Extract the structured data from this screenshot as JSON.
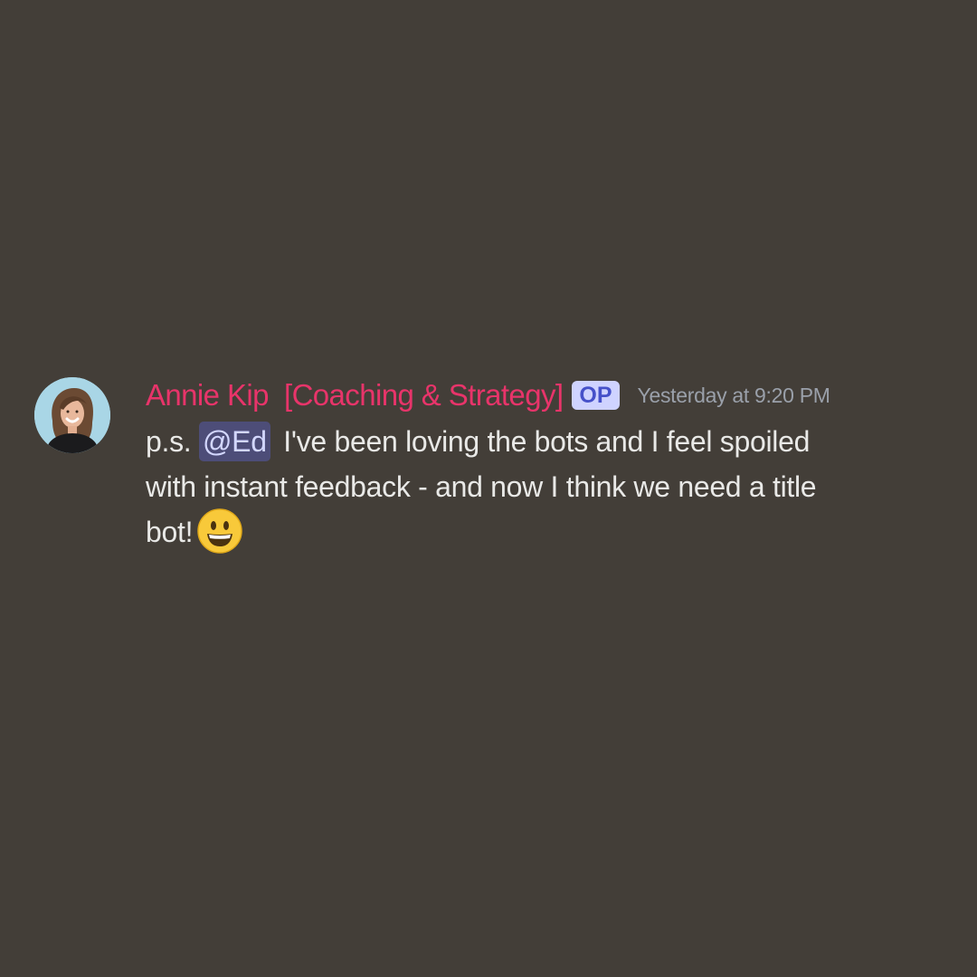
{
  "message": {
    "author": "Annie Kip  [Coaching & Strategy]",
    "badge": "OP",
    "timestamp": "Yesterday at 9:20 PM",
    "text_before_mention": "p.s. ",
    "mention": "@Ed",
    "text_line1_after_mention": " I've been loving the bots and I feel spoiled",
    "text_line2": "with instant feedback - and now I think we need a title",
    "text_line3": "bot!",
    "emoji": "grinning-face-emoji"
  },
  "colors": {
    "background": "#433e38",
    "author": "#e8346a",
    "badge_bg": "#cfd3ff",
    "badge_text": "#4651c9",
    "timestamp": "#9aa0aa",
    "body_text": "#e9e9e7",
    "mention_bg": "#4d4d78",
    "mention_text": "#d3d7ff"
  }
}
